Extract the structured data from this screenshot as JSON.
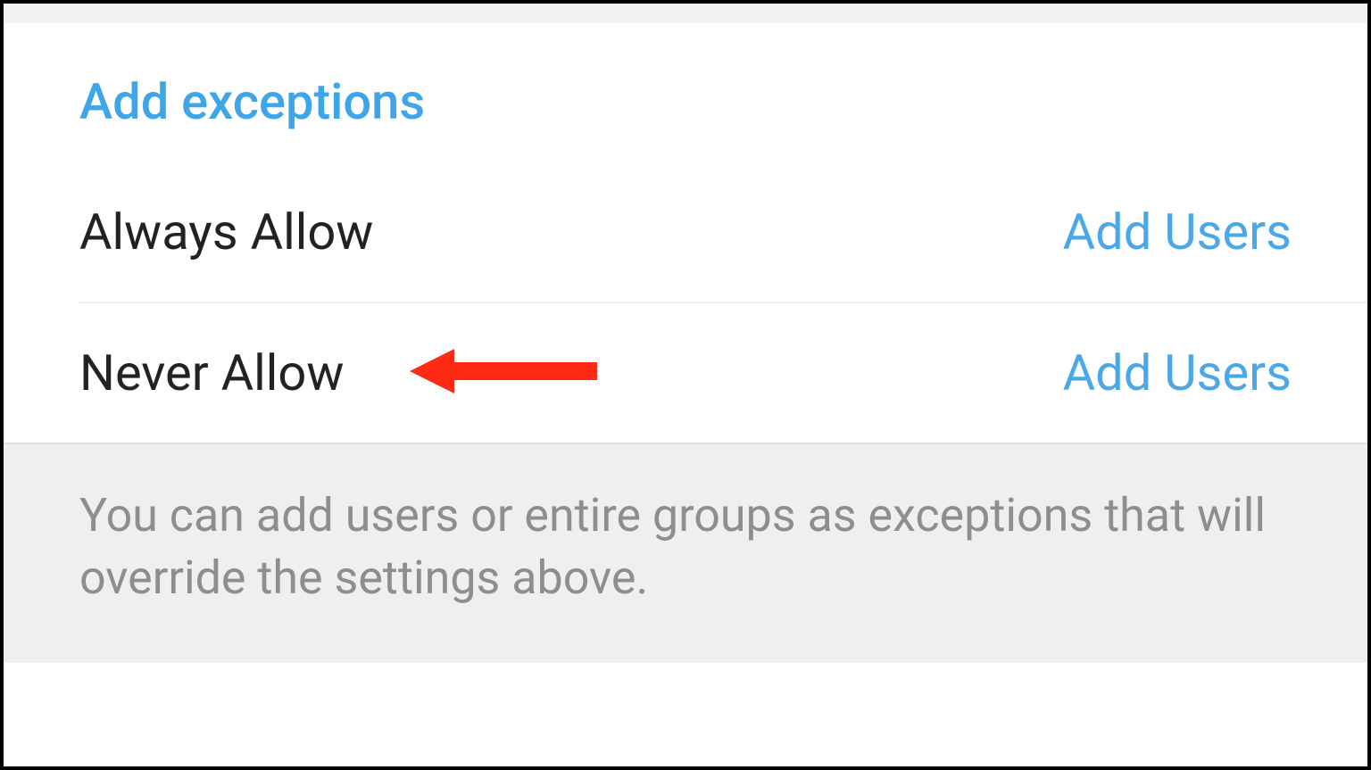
{
  "section": {
    "title": "Add exceptions"
  },
  "rows": [
    {
      "label": "Always Allow",
      "action": "Add Users"
    },
    {
      "label": "Never Allow",
      "action": "Add Users"
    }
  ],
  "footer": {
    "text": "You can add users or entire groups as exceptions that will override the settings above."
  },
  "annotation": {
    "color": "#ff2a13"
  }
}
